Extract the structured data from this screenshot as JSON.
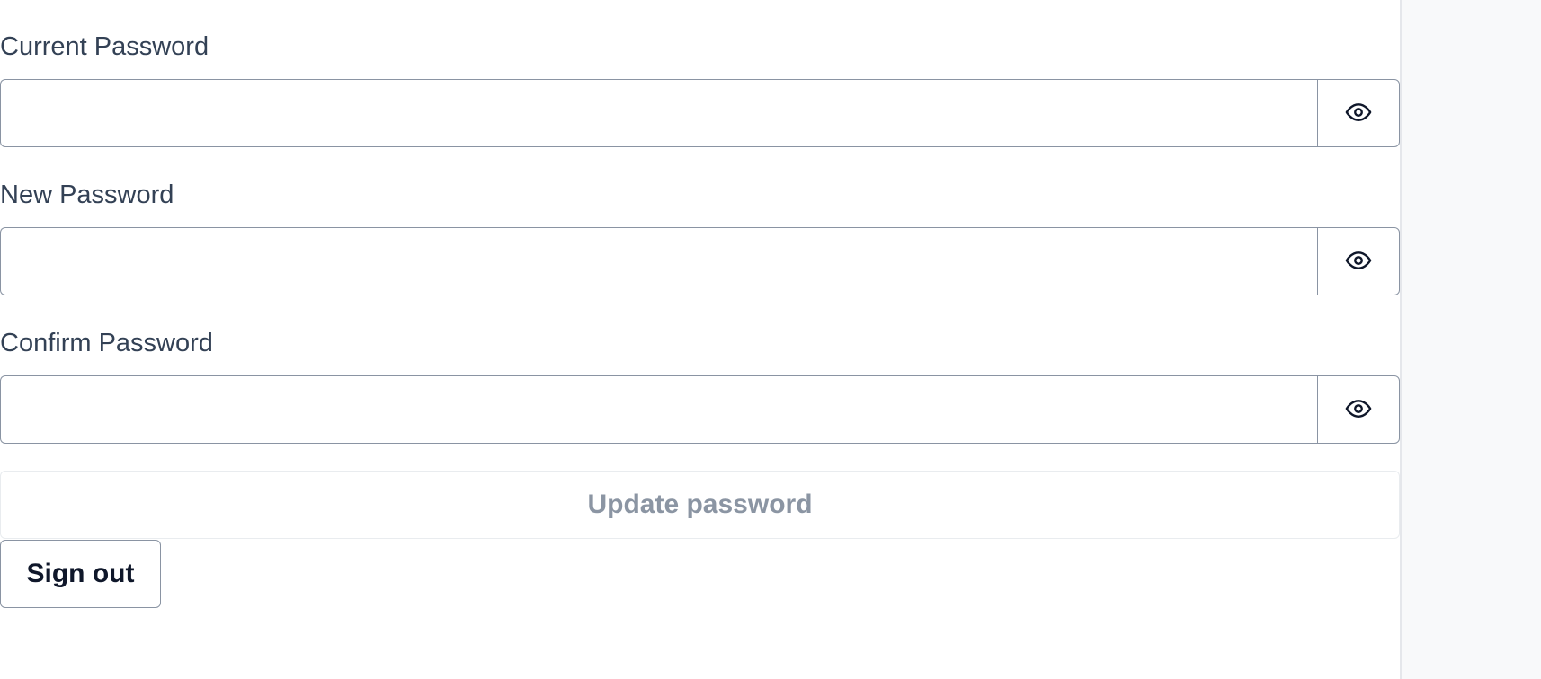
{
  "form": {
    "current_password": {
      "label": "Current Password",
      "value": "",
      "placeholder": "",
      "toggle_icon": "eye-icon"
    },
    "new_password": {
      "label": "New Password",
      "value": "",
      "placeholder": "",
      "toggle_icon": "eye-icon"
    },
    "confirm_password": {
      "label": "Confirm Password",
      "value": "",
      "placeholder": "",
      "toggle_icon": "eye-icon"
    },
    "update_button_label": "Update password",
    "update_button_state": "disabled",
    "signout_button_label": "Sign out"
  },
  "colors": {
    "label_text": "#334155",
    "input_border": "#8a94a3",
    "disabled_text": "#8b95a3",
    "primary_text": "#0f172a"
  }
}
